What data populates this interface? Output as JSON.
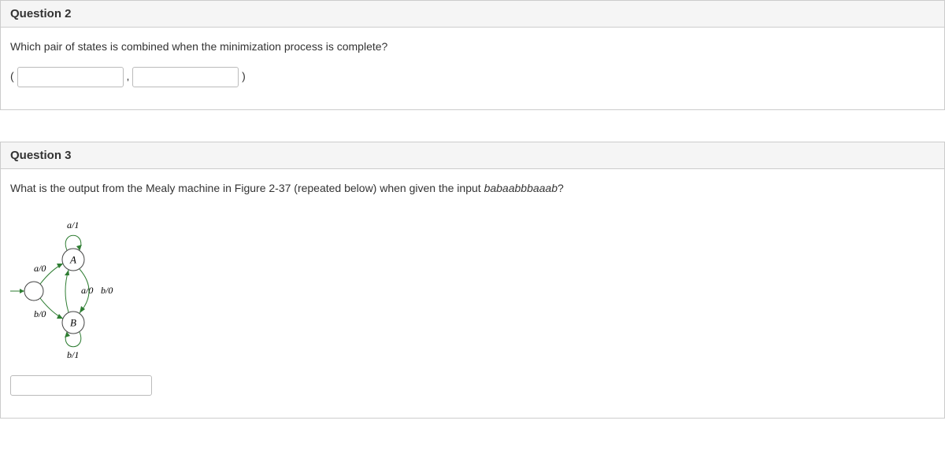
{
  "q2": {
    "header": "Question 2",
    "prompt": "Which pair of states is combined when the minimization process is complete?",
    "open_paren": "(",
    "comma": ",",
    "close_paren": ")"
  },
  "q3": {
    "header": "Question 3",
    "prompt_pre": "What is the output from the Mealy machine in Figure 2-37 (repeated below) when given the input ",
    "prompt_em": "babaabbbaaab",
    "prompt_post": "?",
    "diagram": {
      "state_A": "A",
      "state_B": "B",
      "loop_A": "a/1",
      "loop_B": "b/1",
      "start_to_A": "a/0",
      "start_to_B": "b/0",
      "B_to_A": "a/0",
      "A_to_B": "b/0"
    }
  }
}
